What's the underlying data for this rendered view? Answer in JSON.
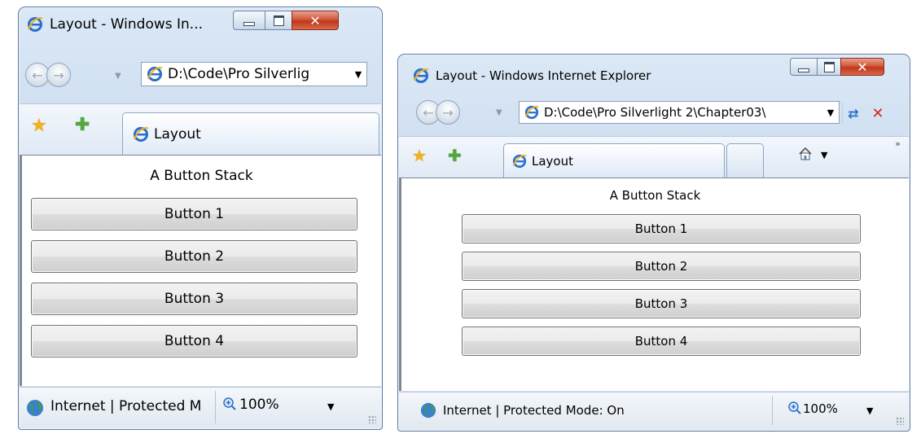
{
  "small_window": {
    "title": "Layout - Windows In...",
    "address": "D:\\Code\\Pro Silverlig",
    "tab_label": "Layout",
    "stack_title": "A Button Stack",
    "buttons": [
      "Button 1",
      "Button 2",
      "Button 3",
      "Button 4"
    ],
    "status": "Internet | Protected M",
    "zoom": "100%"
  },
  "big_window": {
    "title": "Layout - Windows Internet Explorer",
    "address": "D:\\Code\\Pro Silverlight 2\\Chapter03\\",
    "tab_label": "Layout",
    "stack_title": "A Button Stack",
    "buttons": [
      "Button 1",
      "Button 2",
      "Button 3",
      "Button 4"
    ],
    "status": "Internet | Protected Mode: On",
    "zoom": "100%",
    "chevron": "»"
  },
  "colors": {
    "frame": "#c9dbee",
    "close_button": "#c0371c",
    "tab": "#dfeaf7",
    "ie_logo": "#2a6fc9"
  }
}
